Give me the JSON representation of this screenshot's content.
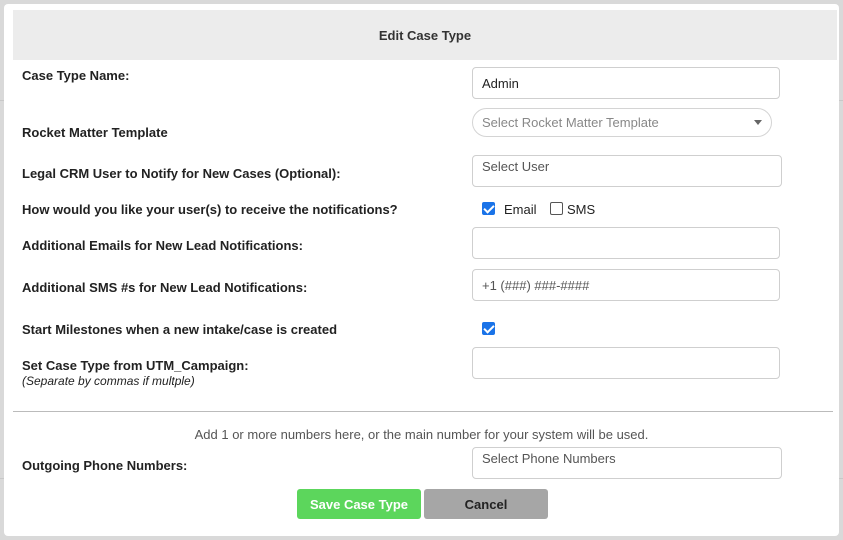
{
  "modal": {
    "title": "Edit Case Type"
  },
  "form": {
    "case_type_name": {
      "label": "Case Type Name:",
      "value": "Admin"
    },
    "rocket_matter_template": {
      "label": "Rocket Matter Template",
      "placeholder": "Select Rocket Matter Template"
    },
    "crm_user": {
      "label": "Legal CRM User to Notify for New Cases (Optional):",
      "placeholder": "Select User"
    },
    "notification_method": {
      "label": "How would you like your user(s) to receive the notifications?",
      "options": [
        {
          "label": "Email",
          "checked": true
        },
        {
          "label": "SMS",
          "checked": false
        }
      ]
    },
    "additional_emails": {
      "label": "Additional Emails for New Lead Notifications:",
      "value": ""
    },
    "additional_sms": {
      "label": "Additional SMS #s for New Lead Notifications:",
      "placeholder": "+1 (###) ###-####"
    },
    "start_milestones": {
      "label": "Start Milestones when a new intake/case is created",
      "checked": true
    },
    "utm_campaign": {
      "label": "Set Case Type from UTM_Campaign:",
      "sublabel": "(Separate by commas if multple)",
      "value": ""
    },
    "phone_hint": "Add 1 or more numbers here, or the main number for your system will be used.",
    "outgoing_phone": {
      "label": "Outgoing Phone Numbers:",
      "placeholder": "Select Phone Numbers"
    }
  },
  "buttons": {
    "save": "Save Case Type",
    "cancel": "Cancel"
  },
  "colors": {
    "save_button": "#5cd65c",
    "cancel_button": "#a6a6a6",
    "checkbox_checked": "#1a73e8",
    "header_bg": "#ececec"
  }
}
